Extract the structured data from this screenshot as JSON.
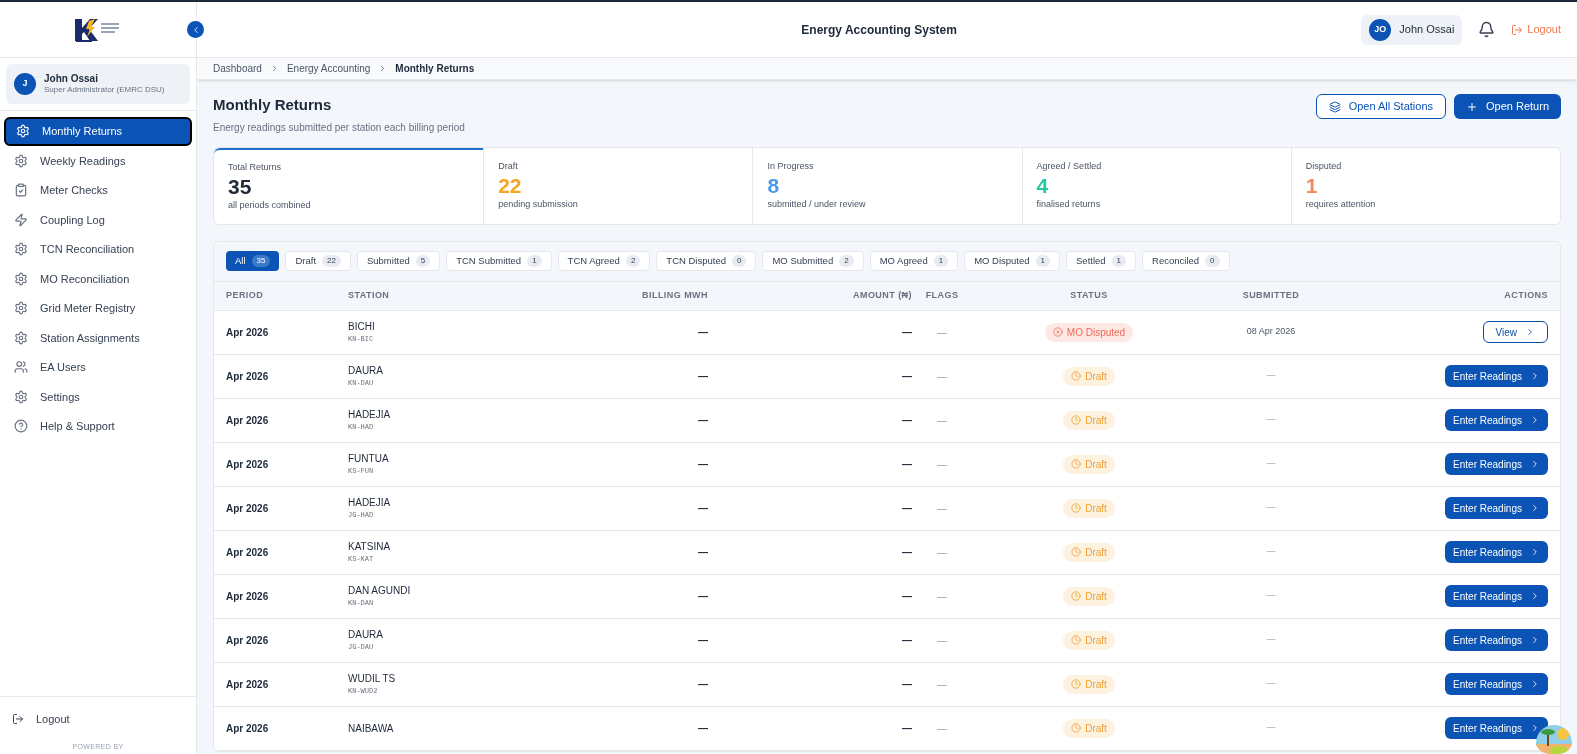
{
  "header": {
    "title": "Energy Accounting System",
    "user_initials": "JO",
    "user_name": "John Ossai",
    "logout": "Logout"
  },
  "sidebar": {
    "user": {
      "initial": "J",
      "name": "John Ossai",
      "role": "Super Administrator (EMRC DSU)"
    },
    "items": [
      {
        "label": "Monthly Returns",
        "kind": "gear",
        "selected": true
      },
      {
        "label": "Weekly Readings",
        "kind": "gear",
        "selected": false
      },
      {
        "label": "Meter Checks",
        "kind": "clipboard",
        "selected": false
      },
      {
        "label": "Coupling Log",
        "kind": "bolt",
        "selected": false
      },
      {
        "label": "TCN Reconciliation",
        "kind": "gear",
        "selected": false
      },
      {
        "label": "MO Reconciliation",
        "kind": "gear",
        "selected": false
      },
      {
        "label": "Grid Meter Registry",
        "kind": "gear",
        "selected": false
      },
      {
        "label": "Station Assignments",
        "kind": "gear",
        "selected": false
      },
      {
        "label": "EA Users",
        "kind": "users",
        "selected": false
      },
      {
        "label": "Settings",
        "kind": "gear",
        "selected": false
      },
      {
        "label": "Help & Support",
        "kind": "help",
        "selected": false
      }
    ],
    "logout": "Logout",
    "powered_by": "POWERED BY"
  },
  "breadcrumb": [
    "Dashboard",
    "Energy Accounting",
    "Monthly Returns"
  ],
  "page": {
    "title": "Monthly Returns",
    "subtitle": "Energy readings submitted per station each billing period",
    "buttons": [
      "Open All Stations",
      "Open Return"
    ]
  },
  "stats": [
    {
      "label": "Total Returns",
      "value": "35",
      "note": "all periods combined",
      "color": "#1f2937",
      "selected": true
    },
    {
      "label": "Draft",
      "value": "22",
      "note": "pending submission",
      "color": "#f5a623",
      "selected": false
    },
    {
      "label": "In Progress",
      "value": "8",
      "note": "submitted / under review",
      "color": "#4a9be8",
      "selected": false
    },
    {
      "label": "Agreed / Settled",
      "value": "4",
      "note": "finalised returns",
      "color": "#20c9a0",
      "selected": false
    },
    {
      "label": "Disputed",
      "value": "1",
      "note": "requires attention",
      "color": "#f28a5b",
      "selected": false
    }
  ],
  "filters": [
    {
      "label": "All",
      "count": "35",
      "selected": true
    },
    {
      "label": "Draft",
      "count": "22",
      "selected": false
    },
    {
      "label": "Submitted",
      "count": "5",
      "selected": false
    },
    {
      "label": "TCN Submitted",
      "count": "1",
      "selected": false
    },
    {
      "label": "TCN Agreed",
      "count": "2",
      "selected": false
    },
    {
      "label": "TCN Disputed",
      "count": "0",
      "selected": false
    },
    {
      "label": "MO Submitted",
      "count": "2",
      "selected": false
    },
    {
      "label": "MO Agreed",
      "count": "1",
      "selected": false
    },
    {
      "label": "MO Disputed",
      "count": "1",
      "selected": false
    },
    {
      "label": "Settled",
      "count": "1",
      "selected": false
    },
    {
      "label": "Reconciled",
      "count": "0",
      "selected": false
    }
  ],
  "table": {
    "columns": [
      "PERIOD",
      "STATION",
      "BILLING MWH",
      "AMOUNT (₦)",
      "FLAGS",
      "STATUS",
      "SUBMITTED",
      "ACTIONS"
    ],
    "rows": [
      {
        "period": "Apr 2026",
        "station": "BICHI",
        "code": "KN-BIC",
        "mwh": "—",
        "amount": "—",
        "flags": "—",
        "status": {
          "label": "MO Disputed",
          "kind": "disputed"
        },
        "submitted": "08 Apr 2026",
        "action": {
          "label": "View",
          "kind": "view"
        }
      },
      {
        "period": "Apr 2026",
        "station": "DAURA",
        "code": "KN-DAU",
        "mwh": "—",
        "amount": "—",
        "flags": "—",
        "status": {
          "label": "Draft",
          "kind": "draft"
        },
        "submitted": "—",
        "action": {
          "label": "Enter Readings",
          "kind": "enter"
        }
      },
      {
        "period": "Apr 2026",
        "station": "HADEJIA",
        "code": "KN-HAD",
        "mwh": "—",
        "amount": "—",
        "flags": "—",
        "status": {
          "label": "Draft",
          "kind": "draft"
        },
        "submitted": "—",
        "action": {
          "label": "Enter Readings",
          "kind": "enter"
        }
      },
      {
        "period": "Apr 2026",
        "station": "FUNTUA",
        "code": "KS-FUN",
        "mwh": "—",
        "amount": "—",
        "flags": "—",
        "status": {
          "label": "Draft",
          "kind": "draft"
        },
        "submitted": "—",
        "action": {
          "label": "Enter Readings",
          "kind": "enter"
        }
      },
      {
        "period": "Apr 2026",
        "station": "HADEJIA",
        "code": "JG-HAD",
        "mwh": "—",
        "amount": "—",
        "flags": "—",
        "status": {
          "label": "Draft",
          "kind": "draft"
        },
        "submitted": "—",
        "action": {
          "label": "Enter Readings",
          "kind": "enter"
        }
      },
      {
        "period": "Apr 2026",
        "station": "KATSINA",
        "code": "KS-KAT",
        "mwh": "—",
        "amount": "—",
        "flags": "—",
        "status": {
          "label": "Draft",
          "kind": "draft"
        },
        "submitted": "—",
        "action": {
          "label": "Enter Readings",
          "kind": "enter"
        }
      },
      {
        "period": "Apr 2026",
        "station": "DAN AGUNDI",
        "code": "KN-DAN",
        "mwh": "—",
        "amount": "—",
        "flags": "—",
        "status": {
          "label": "Draft",
          "kind": "draft"
        },
        "submitted": "—",
        "action": {
          "label": "Enter Readings",
          "kind": "enter"
        }
      },
      {
        "period": "Apr 2026",
        "station": "DAURA",
        "code": "JG-DAU",
        "mwh": "—",
        "amount": "—",
        "flags": "—",
        "status": {
          "label": "Draft",
          "kind": "draft"
        },
        "submitted": "—",
        "action": {
          "label": "Enter Readings",
          "kind": "enter"
        }
      },
      {
        "period": "Apr 2026",
        "station": "WUDIL TS",
        "code": "KN-WUD2",
        "mwh": "—",
        "amount": "—",
        "flags": "—",
        "status": {
          "label": "Draft",
          "kind": "draft"
        },
        "submitted": "—",
        "action": {
          "label": "Enter Readings",
          "kind": "enter"
        }
      },
      {
        "period": "Apr 2026",
        "station": "NAIBAWA",
        "mwh": "—",
        "amount": "—",
        "flags": "—",
        "status": {
          "label": "Draft",
          "kind": "draft"
        },
        "submitted": "—",
        "action": {
          "label": "Enter Readings",
          "kind": "enter"
        }
      }
    ]
  }
}
